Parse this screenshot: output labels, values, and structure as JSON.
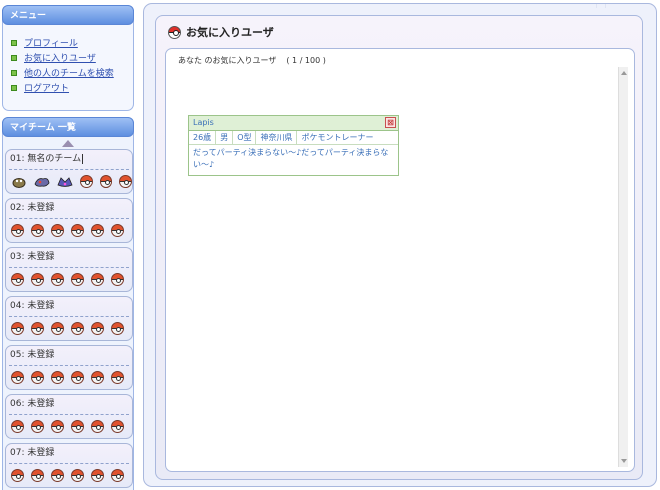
{
  "menu": {
    "header": "メニュー",
    "items": [
      {
        "label": "プロフィール"
      },
      {
        "label": "お気に入りユーザ"
      },
      {
        "label": "他の人のチームを検索"
      },
      {
        "label": "ログアウト"
      }
    ]
  },
  "teams": {
    "header": "マイチーム 一覧",
    "list": [
      {
        "label": "01: 無名のチーム"
      },
      {
        "label": "02: 未登録"
      },
      {
        "label": "03: 未登録"
      },
      {
        "label": "04: 未登録"
      },
      {
        "label": "05: 未登録"
      },
      {
        "label": "06: 未登録"
      },
      {
        "label": "07: 未登録"
      }
    ]
  },
  "main": {
    "title": "お気に入りユーザ",
    "summary_prefix": "あなた のお気に入りユーザ",
    "summary_count": "( 1 / 100 )"
  },
  "user_card": {
    "name": "Lapis",
    "close_glyph": "⊠",
    "fields": [
      "26歳",
      "男",
      "O型",
      "神奈川県",
      "ポケモントレーナー"
    ],
    "comment": "だってパーティ決まらない～♪だってパーティ決まらない～♪"
  }
}
